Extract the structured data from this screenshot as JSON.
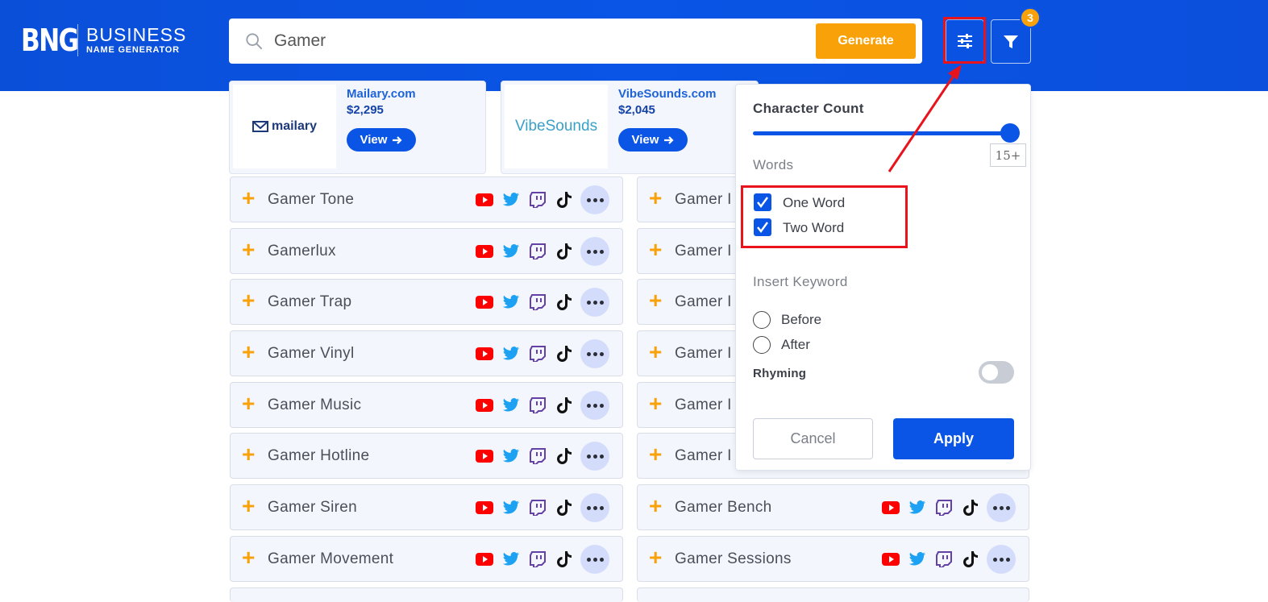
{
  "header": {
    "logo_mark": "BNG",
    "logo_line1": "BUSINESS",
    "logo_line2": "NAME GENERATOR",
    "search_value": "Gamer",
    "generate_label": "Generate",
    "filter_badge_count": "3"
  },
  "premium": [
    {
      "logo_text": "mailary",
      "name": "Mailary.com",
      "price": "$2,295",
      "view_label": "View"
    },
    {
      "logo_text": "VibeSounds",
      "name": "VibeSounds.com",
      "price": "$2,045",
      "view_label": "View"
    }
  ],
  "names_left": [
    "Gamer Tone",
    "Gamerlux",
    "Gamer Trap",
    "Gamer Vinyl",
    "Gamer Music",
    "Gamer Hotline",
    "Gamer Siren",
    "Gamer Movement"
  ],
  "names_right": [
    "Gamer I",
    "Gamer I",
    "Gamer I",
    "Gamer I",
    "Gamer I",
    "Gamer I",
    "Gamer Bench",
    "Gamer Sessions"
  ],
  "panel": {
    "character_count_label": "Character Count",
    "slider_value": "15+",
    "slider_fraction": 1.0,
    "words_label": "Words",
    "one_word_label": "One Word",
    "two_word_label": "Two Word",
    "one_word_checked": true,
    "two_word_checked": true,
    "insert_keyword_label": "Insert Keyword",
    "before_label": "Before",
    "after_label": "After",
    "rhyming_label": "Rhyming",
    "rhyming_on": false,
    "cancel_label": "Cancel",
    "apply_label": "Apply"
  },
  "colors": {
    "brand_blue": "#0a55e6",
    "accent_orange": "#f9a109",
    "highlight_red": "#e8131b",
    "youtube_red": "#ff0000",
    "twitter_blue": "#1da1f2",
    "twitch_purple": "#6441a5"
  },
  "icons": [
    "search-icon",
    "sliders-icon",
    "filter-icon",
    "youtube-icon",
    "twitter-icon",
    "twitch-icon",
    "tiktok-icon",
    "more-icon",
    "arrow-right-icon",
    "checkmark-icon"
  ]
}
